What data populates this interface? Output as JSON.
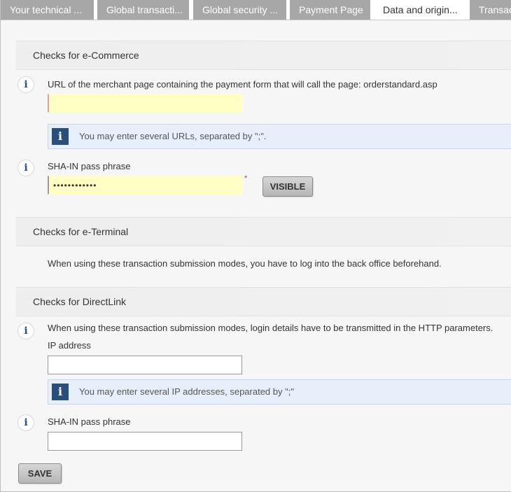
{
  "tabs": [
    {
      "label": "Your technical ..."
    },
    {
      "label": "Global transacti..."
    },
    {
      "label": "Global security ..."
    },
    {
      "label": "Payment Page"
    },
    {
      "label": "Data and origin..."
    },
    {
      "label": "Transac"
    }
  ],
  "ecommerce": {
    "header": "Checks for e-Commerce",
    "url_label": "URL of the merchant page containing the payment form that will call the page: orderstandard.asp",
    "url_value": "",
    "url_hint": "You may enter several URLs, separated by \";\".",
    "sha_label": "SHA-IN pass phrase",
    "sha_value": "••••••••••••",
    "required_mark": "*",
    "visible_button": "VISIBLE"
  },
  "eterminal": {
    "header": "Checks for e-Terminal",
    "note": "When using these transaction submission modes, you have to log into the back office beforehand."
  },
  "directlink": {
    "header": "Checks for DirectLink",
    "note": "When using these transaction submission modes, login details have to be transmitted in the HTTP parameters.",
    "ip_label": "IP address",
    "ip_value": "",
    "ip_hint": "You may enter several IP addresses, separated by \";\"",
    "sha_label": "SHA-IN pass phrase",
    "sha_value": ""
  },
  "save_button": "SAVE",
  "icons": {
    "info": "i"
  },
  "colors": {
    "tab_inactive": "#a7a7a7",
    "required_field": "#ffffc4",
    "hint_background": "#e7effb",
    "info_icon": "#2b4f7c"
  }
}
